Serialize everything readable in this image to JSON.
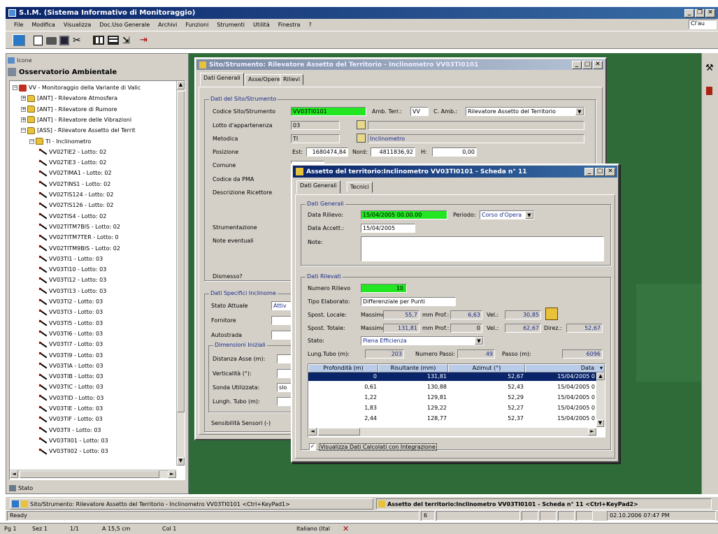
{
  "app": {
    "title": "S.I.M. (Sistema Informativo di Monitoraggio)",
    "menu": [
      "File",
      "Modifica",
      "Visualizza",
      "Doc.Uso Generale",
      "Archivi",
      "Funzioni",
      "Strumenti",
      "Utilità",
      "Finestra",
      "?"
    ],
    "right_fragment": "Cl'au"
  },
  "left_panel": {
    "header": "Icone",
    "title": "Osservatorio Ambientale",
    "tree": {
      "root": "VV - Monitoraggio della Variante di Valic",
      "categories": [
        "[ANT] - Rilevatore Atmosfera",
        "[ANT] - Rilevatore di Rumore",
        "[ANT] - Rilevatore delle Vibrazioni",
        "[ASS] - Rilevatore Assetto del Territ"
      ],
      "subcategory": "TI - Inclinometro",
      "items": [
        "VV02TIE2 - Lotto: 02",
        "VV02TIE3 - Lotto: 02",
        "VV02TIMA1 - Lotto: 02",
        "VV02TINS1 - Lotto: 02",
        "VV02TIS124 - Lotto: 02",
        "VV02TIS126 - Lotto: 02",
        "VV02TIS4 - Lotto: 02",
        "VV02TITM7BIS - Lotto: 02",
        "VV02TITM7TER - Lotto: 0",
        "VV02TITM9BIS - Lotto: 02",
        "VV03TI1 - Lotto: 03",
        "VV03TI10 - Lotto: 03",
        "VV03TI12 - Lotto: 03",
        "VV03TI13 - Lotto: 03",
        "VV03TI2 - Lotto: 03",
        "VV03TI3 - Lotto: 03",
        "VV03TI5 - Lotto: 03",
        "VV03TI6 - Lotto: 03",
        "VV03TI7 - Lotto: 03",
        "VV03TI9 - Lotto: 03",
        "VV03TIA - Lotto: 03",
        "VV03TIB - Lotto: 03",
        "VV03TIC - Lotto: 03",
        "VV03TID - Lotto: 03",
        "VV03TIE - Lotto: 03",
        "VV03TIF - Lotto: 03",
        "VV03TII - Lotto: 03",
        "VV03TII01 - Lotto: 03",
        "VV03TII02 - Lotto: 03"
      ]
    },
    "footer": "Stato"
  },
  "win1": {
    "title": "Sito/Strumento: Rilevatore Assetto del Territorio - Inclinometro VV03TI0101",
    "tabs": [
      "Dati Generali",
      "Asse/Opere",
      "Rilievi"
    ],
    "group_title": "Dati del Sito/Strumento",
    "codice_label": "Codice Sito/Strumento",
    "codice_value": "VV03TI0101",
    "ambito_label": "Amb. Terr.:",
    "ambito_value": "VV",
    "c_amb_label": "C. Amb.:",
    "c_amb_value": "Rilevatore Assetto del Territorio",
    "lotto_label": "Lotto d'appartenenza",
    "lotto_value": "03",
    "metodica_label": "Metodica",
    "metodica_value": "TI",
    "metodica_desc": "Inclinometro",
    "posizione_label": "Posizione",
    "est_label": "Est:",
    "est_value": "1680474,84",
    "nord_label": "Nord:",
    "nord_value": "4811836,92",
    "h_label": "H:",
    "h_value": "0,00",
    "comune_label": "Comune",
    "codice_pma_label": "Codice da PMA",
    "descrizione_label": "Descrizione Ricettore",
    "strumentazione_label": "Strumentazione",
    "note_label": "Note eventuali",
    "dismesso_label": "Dismesso?",
    "specific_group": "Dati Specifici Inclinome",
    "stato_label": "Stato Attuale",
    "stato_value": "Attiv",
    "fornitore_label": "Fornitore",
    "autostrada_label": "Autostrada",
    "dimensioni_group": "Dimensioni Iniziali",
    "distanza_label": "Distanza Asse (m):",
    "verticalita_label": "Verticalità (°):",
    "sonda_label": "Sonda Utilizzata:",
    "sonda_value": "slo",
    "lungh_label": "Lungh. Tubo (m):",
    "sensibilita_label": "Sensibilità Sensori (-)"
  },
  "win2": {
    "title": "Assetto del territorio:Inclinometro VV03TI0101 - Scheda n° 11",
    "tabs": [
      "Dati Generali",
      "Tecnici"
    ],
    "gen_group": "Dati Generali",
    "data_rilievo_label": "Data Rilievo:",
    "data_rilievo_value": "15/04/2005 00.00.00",
    "periodo_label": "Periodo:",
    "periodo_value": "Corso d'Opera",
    "data_accett_label": "Data Accett.:",
    "data_accett_value": "15/04/2005",
    "note_label": "Note:",
    "ril_group": "Dati Rilevati",
    "numero_label": "Numero Rilievo",
    "numero_value": "10",
    "tipo_label": "Tipo Elaborato:",
    "tipo_value": "Differenziale per Punti",
    "spost_locale_label": "Spost. Locale:",
    "spost_totale_label": "Spost. Totale:",
    "massimo_label": "Massimo",
    "prof_label": "mm Prof.:",
    "vel_label": "Vel.:",
    "dirz_label": "Direz.:",
    "spost_locale_max": "55,7",
    "spost_locale_prof": "6,63",
    "spost_locale_vel": "30,85",
    "spost_totale_max": "131,81",
    "spost_totale_prof": "0",
    "spost_totale_vel": "62,67",
    "spost_totale_dir": "52,67",
    "stato_label": "Stato:",
    "stato_value": "Piena Efficienza",
    "lung_tubo_label": "Lung.Tubo (m):",
    "lung_tubo_value": "203",
    "numero_passi_label": "Numero Passi:",
    "numero_passi_value": "49",
    "passo_label": "Passo (m):",
    "passo_value": "6096",
    "table_headers": [
      "Profondità (m)",
      "Risultante (mm)",
      "Azimut (°)",
      "Data"
    ],
    "table_rows": [
      [
        "0",
        "131,81",
        "52,67",
        "15/04/2005 0"
      ],
      [
        "0,61",
        "130,88",
        "52,43",
        "15/04/2005 0"
      ],
      [
        "1,22",
        "129,81",
        "52,29",
        "15/04/2005 0"
      ],
      [
        "1,83",
        "129,22",
        "52,27",
        "15/04/2005 0"
      ],
      [
        "2,44",
        "128,77",
        "52,37",
        "15/04/2005 0"
      ]
    ],
    "checkbox_label": "Visualizza Dati Calcolati con Integrazione",
    "checkbox_checked": true
  },
  "mdi_taskbar": {
    "item1": "Sito/Strumento: Rilevatore Assetto del Territorio - Inclinometro VV03TI0101 <Ctrl+KeyPad1>",
    "item2": "Assetto del territorio:Inclinometro VV03TI0101 - Scheda n° 11 <Ctrl+KeyPad2>"
  },
  "status_bar": {
    "ready": "Ready",
    "num": "6",
    "datetime": "02.10.2006 07:47 PM"
  },
  "word_status": {
    "pg": "Pg 1",
    "sez": "Sez 1",
    "pages": "1/1",
    "pos": "A 15,5 cm",
    "col": "Col 1",
    "lang": "Italiano (Ital"
  },
  "colors": {
    "desktop": "#2e6b38",
    "field_green": "#22e622",
    "title_active": "#0a246a",
    "title_inactive": "#7b8aa5",
    "grid_header": "#b9cdea"
  }
}
